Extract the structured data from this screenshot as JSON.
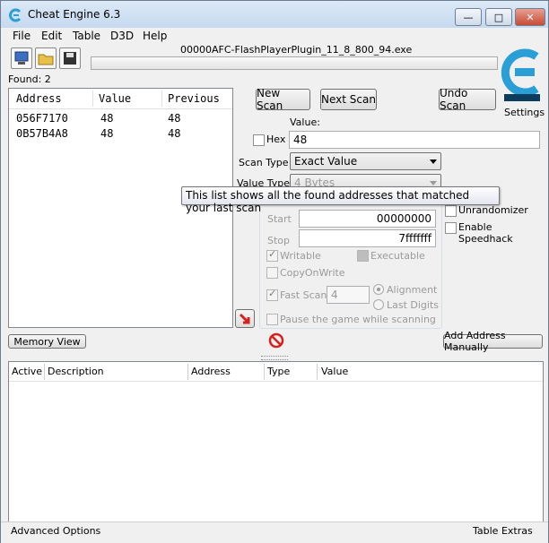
{
  "window": {
    "title": "Cheat Engine 6.3",
    "minimize": "—",
    "maximize": "□",
    "close": "✕"
  },
  "menu": [
    "File",
    "Edit",
    "Table",
    "D3D",
    "Help"
  ],
  "toolbar": {
    "process_name": "00000AFC-FlashPlayerPlugin_11_8_800_94.exe",
    "settings_label": "Settings"
  },
  "found_label": "Found: 2",
  "results": {
    "columns": [
      "Address",
      "Value",
      "Previous"
    ],
    "rows": [
      {
        "address": "056F7170",
        "value": "48",
        "previous": "48"
      },
      {
        "address": "0B57B4A8",
        "value": "48",
        "previous": "48"
      }
    ]
  },
  "scan": {
    "new_scan": "New Scan",
    "next_scan": "Next Scan",
    "undo_scan": "Undo Scan",
    "value_label": "Value:",
    "hex_label": "Hex",
    "value": "48",
    "scan_type_label": "Scan Type",
    "scan_type": "Exact Value",
    "value_type_label": "Value Type",
    "value_type": "4 Bytes",
    "start_label": "Start",
    "start": "00000000",
    "stop_label": "Stop",
    "stop": "7fffffff",
    "writable": "Writable",
    "executable": "Executable",
    "copy_on_write": "CopyOnWrite",
    "fast_scan": "Fast Scan",
    "fast_scan_value": "4",
    "alignment": "Alignment",
    "last_digits": "Last Digits",
    "pause_game": "Pause the game while scanning",
    "unrandomizer": "Unrandomizer",
    "enable_speedhack": "Enable Speedhack"
  },
  "tooltip": "This list shows all the found addresses that matched your last scan",
  "memory_view": "Memory View",
  "add_address": "Add Address Manually",
  "address_table": {
    "columns": [
      "Active",
      "Description",
      "Address",
      "Type",
      "Value"
    ]
  },
  "status": {
    "left": "Advanced Options",
    "right": "Table Extras"
  },
  "colors": {
    "logo": "#2a9fd6",
    "arrow": "#d8201c"
  }
}
